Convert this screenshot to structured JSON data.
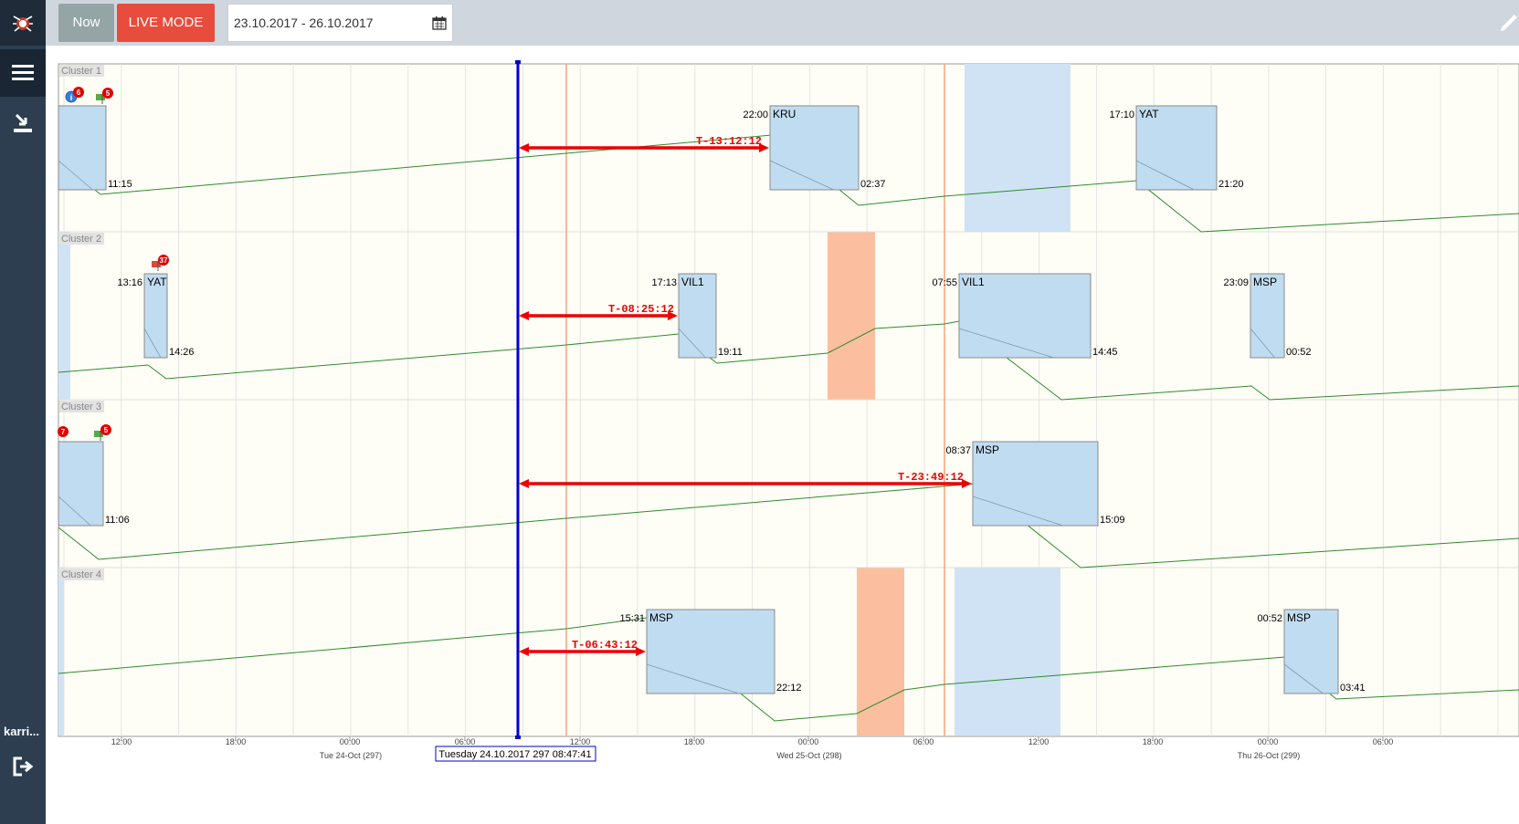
{
  "app": {
    "logo_icon": "bug-logo-icon",
    "user_label": "karri..."
  },
  "toolbar": {
    "now_label": "Now",
    "live_label": "LIVE MODE",
    "date_range": "23.10.2017 - 26.10.2017"
  },
  "colors": {
    "live": "#e74c3c",
    "now": "#95a5a6",
    "cursor": "#0000cc",
    "countdown": "#ee0000",
    "task_fill": "#c0dcf0",
    "trend_line": "#2e8b2e",
    "orange_band": "#fbbf9f",
    "blue_band": "#cfe3f5"
  },
  "timeline": {
    "cursor_label": "Tuesday 24.10.2017 297 08:47:41",
    "time_ticks": [
      "12:00",
      "18:00",
      "00:00",
      "06:00",
      "12:00",
      "18:00",
      "00:00",
      "06:00",
      "12:00",
      "18:00",
      "00:00",
      "06:00"
    ],
    "day_labels": [
      "Tue 24-Oct (297)",
      "Wed 25-Oct (298)",
      "Thu 26-Oct (299)"
    ]
  },
  "clusters": [
    {
      "label": "Cluster 1",
      "badges": [
        {
          "icon": "info-icon",
          "count": "6"
        },
        {
          "icon": "flag-green-icon",
          "count": "5"
        }
      ],
      "countdown": "T-13:12:12",
      "tasks": [
        {
          "code": "",
          "start": "",
          "end": "11:15"
        },
        {
          "code": "KRU",
          "start": "22:00",
          "end": "02:37"
        },
        {
          "code": "YAT",
          "start": "17:10",
          "end": "21:20"
        }
      ]
    },
    {
      "label": "Cluster 2",
      "badges": [
        {
          "icon": "flag-red-icon",
          "count": "37"
        }
      ],
      "countdown": "T-08:25:12",
      "tasks": [
        {
          "code": "YAT",
          "start": "13:16",
          "end": "14:26"
        },
        {
          "code": "VIL1",
          "start": "17:13",
          "end": "19:11"
        },
        {
          "code": "VIL1",
          "start": "07:55",
          "end": "14:45"
        },
        {
          "code": "MSP",
          "start": "23:09",
          "end": "00:52"
        }
      ]
    },
    {
      "label": "Cluster 3",
      "badges": [
        {
          "icon": "alert-icon",
          "count": "7"
        },
        {
          "icon": "flag-green-icon",
          "count": "5"
        }
      ],
      "countdown": "T-23:49:12",
      "tasks": [
        {
          "code": "",
          "start": "",
          "end": "11:06"
        },
        {
          "code": "MSP",
          "start": "08:37",
          "end": "15:09"
        }
      ]
    },
    {
      "label": "Cluster 4",
      "badges": [],
      "countdown": "T-06:43:12",
      "tasks": [
        {
          "code": "MSP",
          "start": "15:31",
          "end": "22:12"
        },
        {
          "code": "MSP",
          "start": "00:52",
          "end": "03:41"
        }
      ]
    }
  ]
}
